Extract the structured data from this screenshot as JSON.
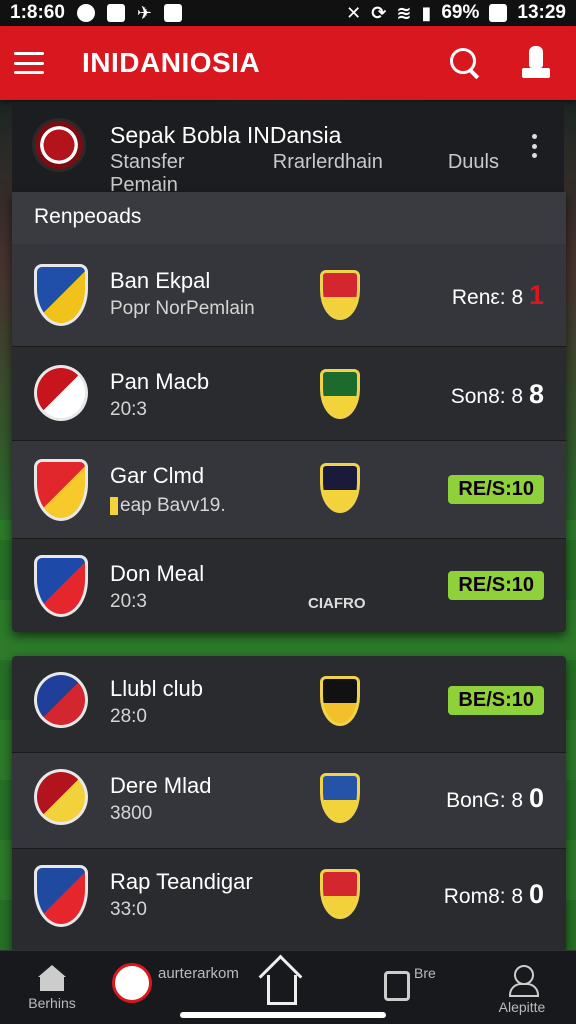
{
  "status_bar": {
    "time_left": "1:8:60",
    "battery": "69%",
    "time_right": "13:29"
  },
  "app_bar": {
    "title": "INIDANIOSIA"
  },
  "league": {
    "title": "Sepak Bobla INDansia",
    "tabs": [
      "Stansfer Pemain",
      "Rrarlerdhain",
      "Duuls"
    ]
  },
  "panel": {
    "heading": "Renрeoads"
  },
  "matches": [
    {
      "team": "Ban Ekpal",
      "sub": "Popr NorPemlain",
      "score_label": "Renε: 8",
      "score_num": "1",
      "color_a": "#1f4fa8",
      "color_b": "#f1c21b",
      "opp_a": "#d4262e",
      "opp_b": "#f3d13b",
      "alt": true
    },
    {
      "team": "Pan Macb",
      "sub": "20:3",
      "score_label": "Son8: 8",
      "score_num": "8",
      "color_a": "#c8141d",
      "color_b": "#ffffff",
      "opp_a": "#1d6b2c",
      "opp_b": "#f2d33a",
      "alt": false
    },
    {
      "team": "Gar Clmd",
      "sub": "eap Bavv19.",
      "score_label": "RE/S:1",
      "score_num": "0",
      "color_a": "#e1262c",
      "color_b": "#f7c92a",
      "opp_a": "#1a1a3a",
      "opp_b": "#f2d33a",
      "alt": true
    },
    {
      "team": "Don Meal",
      "sub": "20:3",
      "score_label": "RE/S:1",
      "score_num": "0",
      "color_a": "#1d4aa8",
      "color_b": "#e5262c",
      "opp_text": "CIAFRO",
      "alt": false
    },
    {
      "team": "Llubl club",
      "sub": "28:0",
      "score_label": "BE/S:1",
      "score_num": "0",
      "color_a": "#203f9a",
      "color_b": "#d4262e",
      "opp_a": "#111",
      "opp_b": "#f2c02a",
      "alt": false
    },
    {
      "team": "Dere Mlad",
      "sub": "3800",
      "score_label": "BonG: 8",
      "score_num": "0",
      "color_a": "#b1141c",
      "color_b": "#f3d13b",
      "opp_a": "#2453a8",
      "opp_b": "#f2d33a",
      "alt": true
    },
    {
      "team": "Rap Teandigar",
      "sub": "33:0",
      "score_label": "Rom8: 8",
      "score_num": "0",
      "color_a": "#2049a0",
      "color_b": "#e5262c",
      "opp_a": "#d4262e",
      "opp_b": "#f3d13b",
      "alt": false
    }
  ],
  "bottom_nav": [
    {
      "label": "Berhins",
      "icon": "home-icon"
    },
    {
      "label": "aurterarkom",
      "icon": "ball-icon"
    },
    {
      "label": "",
      "icon": "house-icon"
    },
    {
      "label": "Bre",
      "icon": "doc-icon"
    },
    {
      "label": "Alepitte",
      "icon": "user-icon"
    }
  ],
  "colors": {
    "brand": "#d9171f",
    "badge_green": "#8fd13a"
  }
}
